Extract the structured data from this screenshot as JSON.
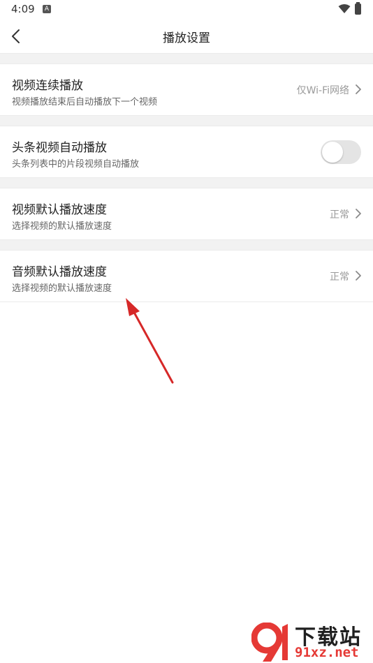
{
  "status_bar": {
    "time": "4:09",
    "notification_icon": "A"
  },
  "header": {
    "title": "播放设置"
  },
  "settings": [
    {
      "title": "视频连续播放",
      "subtitle": "视频播放结束后自动播放下一个视频",
      "value": "仅Wi-Fi网络"
    },
    {
      "title": "头条视频自动播放",
      "subtitle": "头条列表中的片段视频自动播放",
      "toggle_on": false
    },
    {
      "title": "视频默认播放速度",
      "subtitle": "选择视频的默认播放速度",
      "value": "正常"
    },
    {
      "title": "音频默认播放速度",
      "subtitle": "选择视频的默认播放速度",
      "value": "正常"
    }
  ],
  "watermark": {
    "line1": "下载站",
    "line2": "91xz.net"
  },
  "colors": {
    "annotation_arrow": "#d62828",
    "toggle_off": "#e4e4e4",
    "separator": "#f2f2f2"
  }
}
